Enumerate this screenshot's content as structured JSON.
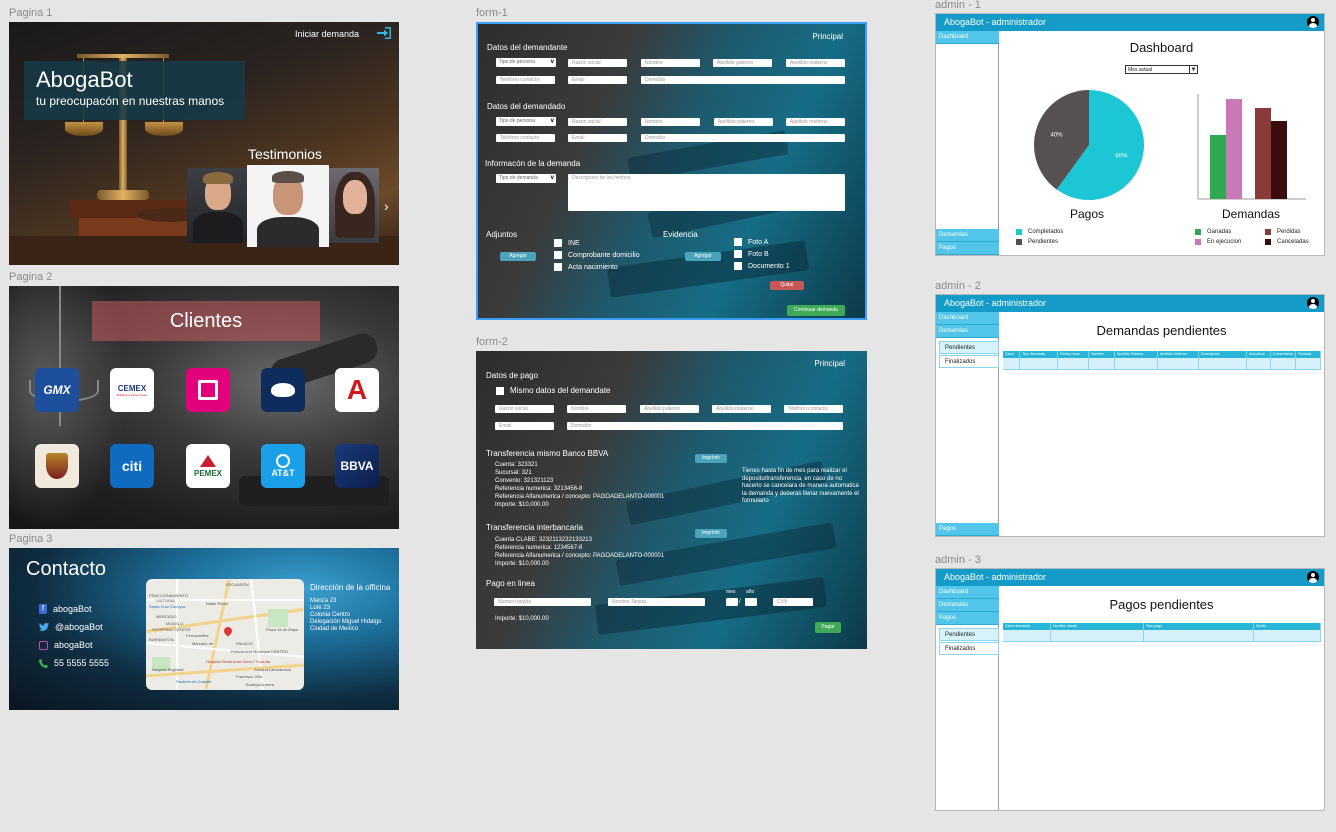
{
  "labels": {
    "p1": "Pagina 1",
    "p2": "Pagina 2",
    "p3": "Pagina 3",
    "f1": "form-1",
    "f2": "form-2",
    "a1": "admin - 1",
    "a2": "admin - 2",
    "a3": "admin - 3"
  },
  "page1": {
    "start_label": "Iniciar demanda",
    "brand": "AbogaBot",
    "tagline": "tu preocupacón en nuestras manos",
    "testimonials_title": "Testimonios",
    "next_arrow": "›"
  },
  "page2": {
    "title": "Clientes",
    "logos": [
      "GMX",
      "CEMEX",
      "Liverpool",
      "Aeroméxico",
      "Autozone",
      "Coat of arms",
      "citi",
      "PEMEX",
      "AT&T",
      "BBVA"
    ],
    "logo_text": {
      "gmx": "GMX",
      "cemex": "CEMEX",
      "cemex_sub": "Building a better future",
      "citi": "citi",
      "pemex": "PEMEX",
      "att": "AT&T",
      "bbva": "BBVA",
      "autozone": "A"
    }
  },
  "page3": {
    "title": "Contacto",
    "facebook": "abogaBot",
    "twitter": "@abogaBot",
    "instagram": "abogaBot",
    "phone": "55 5555 5555",
    "address_title": "Dirección de la officina",
    "address_lines": [
      "Manza 23",
      "Lote 23",
      "Colonia Centro",
      "Delegación Miguel Hidalgo",
      "Ciudad de Mexico"
    ],
    "map_labels": [
      "ESCANDÓN",
      "FRACCIONAMIENTO",
      "VICTORIA",
      "Santa Cruz Cocoyoc",
      "Nadie Panor",
      "MERCADO",
      "MODELO",
      "SHOPPING CENTER",
      "BUENAVISTA",
      "Ferrocarriles",
      "Mercado de",
      "PALACIO",
      "CENTRO",
      "Presidencia Municipal",
      "Hospital General de Zona 7 Cuautla",
      "Plaza 16 de Mayo",
      "Soriana Laboratorios",
      "Panteón de Cuautla",
      "Hospital Regional",
      "Francisco Villa",
      "Bodega Aurrera"
    ]
  },
  "form1": {
    "principal": "Principal",
    "demandante_title": "Datos del demandante",
    "demandado_title": "Datos del demandado",
    "info_title": "Informacón de la demanda",
    "tipo_persona": "Tipo de persona",
    "razon_social": "Razon social",
    "nombre": "Nombre",
    "ap_paterno": "Apellido paterno",
    "ap_materno": "Apellido materno",
    "telefono": "Telefono contacto",
    "email": "Email",
    "domicilio": "Domicilio",
    "tipo_demanda": "Tipo de demanda",
    "descripcion": "Descripcion de los hechos",
    "adjuntos": "Adjuntos",
    "evidencia": "Evidencia",
    "agregar": "Agregar",
    "adj_items": [
      "INE",
      "Comprobante domicilio",
      "Acta nacimiento"
    ],
    "ev_items": [
      "Foto A",
      "Foto B",
      "Documento 1"
    ],
    "quitar": "Quitar",
    "continuar": "Continuar demanda"
  },
  "form2": {
    "principal": "Principal",
    "datos_pago": "Datos de pago",
    "mismo": "Mismo datos del demandate",
    "razon_social": "Razon social",
    "nombre": "Nombre",
    "ap_paterno": "Apellido paterno",
    "ap_materno": "Apellido materno",
    "telefono": "Telefono contacto",
    "email": "Email",
    "domicilio": "Domicilio",
    "bbva_title": "Transferencia mismo Banco BBVA",
    "bbva_lines": [
      "Cuenta: 323321",
      "Sucursal: 321",
      "Convenio: 321321123",
      "Referencia numerica: 3213456-8",
      "Referencia Alfanumerica / concepto: PAGOADELANTO-000001",
      "Importe: $10,000.00"
    ],
    "imprimir": "Imprimir",
    "note": "Tienes hasta fin de mes para realizar el deposito/transferencia, en caso de no hacerlo se cancelara de manera automatica la demanda y deberas llenar nuevamente el formulario",
    "inter_title": "Transferencia interbancaria",
    "inter_lines": [
      "Cuenta CLABE: 3232113232133213",
      "Referencia numerica: 1234567-8",
      "Referencia Alfanumerica / concepto: PAGOADELANTO-000001",
      "Importe: $10,000.00"
    ],
    "online_title": "Pago en linea",
    "numero_tarjeta": "Numero tarjeta",
    "nombre_tarjeta": "Nombre Tarjeta",
    "mes": "mes",
    "anio": "año",
    "slash": "/",
    "cvv": "CVV",
    "importe": "Importe: $10,000.00",
    "pagar": "Pagar"
  },
  "admin1": {
    "topbar": "AbogaBot - administrador",
    "nav_dashboard": "Dashboard",
    "nav_demandas": "Demandas",
    "nav_pagos": "Pagos",
    "title": "Dashboard",
    "period": "Mes actual",
    "pie_title": "Pagos",
    "bar_title": "Demandas",
    "pie_legend": [
      "Completados",
      "Pendientes"
    ],
    "bar_legend": [
      "Ganadas",
      "Perdidas",
      "En ejecucion",
      "Canceladas"
    ],
    "colors": {
      "teal": "#1cc6d4",
      "dark": "#575050",
      "green": "#2fa84f",
      "pink": "#c978b8",
      "brown": "#8b3a3a",
      "maroon": "#3a0d0d"
    }
  },
  "chart_data": [
    {
      "type": "pie",
      "title": "Pagos",
      "series": [
        {
          "name": "Completados",
          "value": 60
        },
        {
          "name": "Pendientes",
          "value": 40
        }
      ],
      "data_labels": [
        "60%",
        "40%"
      ]
    },
    {
      "type": "bar",
      "title": "Demandas",
      "categories": [
        "Ganadas",
        "En ejecucion",
        "Perdidas",
        "Canceladas"
      ],
      "values": [
        64,
        100,
        91,
        78
      ],
      "colors": [
        "#2fa84f",
        "#c978b8",
        "#8b3a3a",
        "#3a0d0d"
      ]
    }
  ],
  "admin2": {
    "topbar": "AbogaBot - administrador",
    "nav_dashboard": "Dashboard",
    "nav_demandas": "Demandas",
    "sub_pendientes": "Pendientes",
    "sub_finalizados": "Finalizados",
    "nav_pagos": "Pagos",
    "title": "Demandas pendientes",
    "columns": [
      "Clave",
      "Tipo demanda",
      "Fecha creac",
      "Nombre",
      "Apellido Paterno",
      "Apellido Materno",
      "Descripción",
      "Actualizar",
      "Comentarios",
      "Finalizar"
    ]
  },
  "admin3": {
    "topbar": "AbogaBot - administrador",
    "nav_dashboard": "Dashboard",
    "nav_demandas": "Demandas",
    "nav_pagos": "Pagos",
    "sub_pendientes": "Pendientes",
    "sub_finalizados": "Finalizados",
    "title": "Pagos pendientes",
    "columns": [
      "Clave demanda",
      "Nombre cliente",
      "Tipo pago",
      "Monto"
    ]
  }
}
